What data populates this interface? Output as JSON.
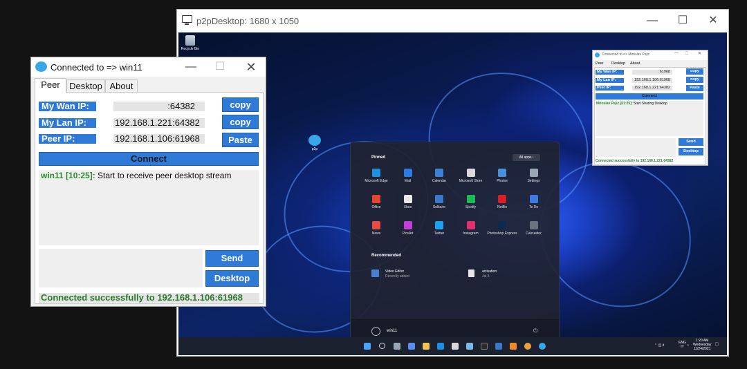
{
  "remote_window": {
    "title": "p2pDesktop: 1680 x 1050",
    "minimize_icon": "minimize-icon",
    "maximize_icon": "maximize-icon",
    "close_icon": "close-icon"
  },
  "remote_desktop": {
    "recycle_bin_label": "Recycle Bin",
    "p2p_shortcut_label": "p2p",
    "start_menu": {
      "pinned_label": "Pinned",
      "all_apps_label": "All apps",
      "apps": [
        {
          "label": "Microsoft Edge",
          "color": "#1f8fe0"
        },
        {
          "label": "Mail",
          "color": "#2c7be5"
        },
        {
          "label": "Calendar",
          "color": "#3b82d6"
        },
        {
          "label": "Microsoft Store",
          "color": "#d9d9d9"
        },
        {
          "label": "Photos",
          "color": "#4a90d9"
        },
        {
          "label": "Settings",
          "color": "#9aa5b5"
        },
        {
          "label": "Office",
          "color": "#e3462f"
        },
        {
          "label": "Xbox",
          "color": "#e8e8e8"
        },
        {
          "label": "Solitaire",
          "color": "#3a78c9"
        },
        {
          "label": "Spotify",
          "color": "#1db954"
        },
        {
          "label": "Netflix",
          "color": "#d81f26"
        },
        {
          "label": "To Do",
          "color": "#3f7be0"
        },
        {
          "label": "News",
          "color": "#e54d42"
        },
        {
          "label": "PicsArt",
          "color": "#c13fd6"
        },
        {
          "label": "Twitter",
          "color": "#1da1f2"
        },
        {
          "label": "Instagram",
          "color": "#e1306c"
        },
        {
          "label": "Photoshop Express",
          "color": "#0c2a4d"
        },
        {
          "label": "Calculator",
          "color": "#6b7280"
        }
      ],
      "recommended_label": "Recommended",
      "recommended": [
        {
          "title": "Video Editor",
          "subtitle": "Recently added"
        },
        {
          "title": "activation",
          "subtitle": "Jul 5"
        }
      ],
      "user_name": "win11"
    },
    "taskbar": {
      "language_top": "ENG",
      "language_bottom": "IT",
      "time": "1:20 AM",
      "day": "Wednesday",
      "date": "11/24/2021"
    },
    "mini_window": {
      "title": "Connected to => Miroslav Pejic",
      "tabs": [
        "Peer",
        "Desktop",
        "About"
      ],
      "wan_label": "My Wan IP:",
      "wan_value": ":61968",
      "lan_label": "My Lan IP:",
      "lan_value": "192.168.1.106:61968",
      "peer_label": "Peer IP:",
      "peer_value": "192.168.1.221:64382",
      "copy_label": "copy",
      "paste_label": "Paste",
      "connect_label": "Connect",
      "log_user": "Miroslav Pejic [01:25]:",
      "log_message": "Start Sharing Desktop",
      "send_label": "Send",
      "desktop_label": "Desktop",
      "status": "Connected successfully to 192.168.1.221:64382"
    }
  },
  "p2p_window": {
    "title": "Connected to => win11",
    "tabs": [
      "Peer",
      "Desktop",
      "About"
    ],
    "wan_label": "My Wan IP:",
    "wan_value": ":64382",
    "lan_label": "My Lan IP:",
    "lan_value": "192.168.1.221:64382",
    "peer_label": "Peer IP:",
    "peer_value": "192.168.1.106:61968",
    "copy_label": "copy",
    "paste_label": "Paste",
    "connect_label": "Connect",
    "log_user": "win11 [10:25]:",
    "log_message": " Start to receive peer desktop stream",
    "message_input": "",
    "send_label": "Send",
    "desktop_label": "Desktop",
    "status": "Connected successfully to 192.168.1.106:61968"
  },
  "colors": {
    "accent_blue": "#2f7ad6",
    "success_green": "#2d7a2d"
  }
}
